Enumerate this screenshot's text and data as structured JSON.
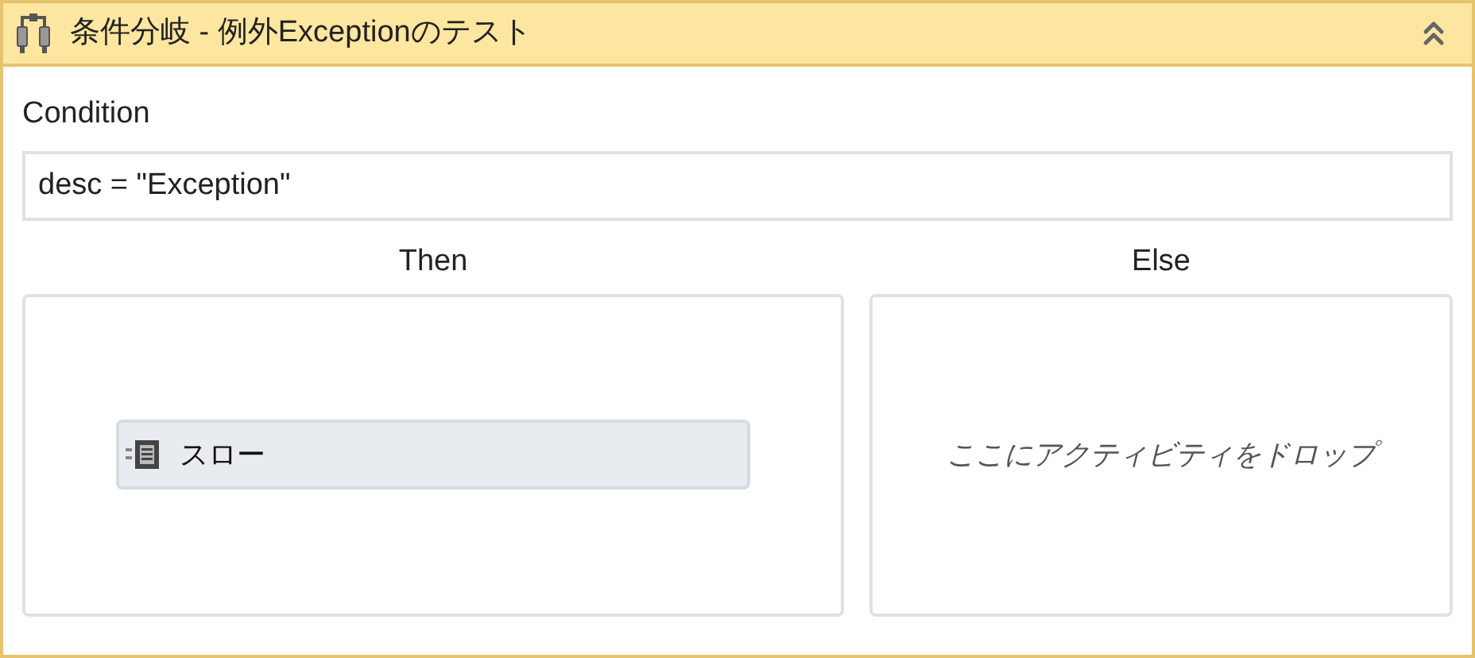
{
  "header": {
    "title": "条件分岐 - 例外Exceptionのテスト",
    "expanded": true
  },
  "condition": {
    "label": "Condition",
    "value": "desc = \"Exception\""
  },
  "branches": [
    {
      "label": "Then",
      "kind": "activities",
      "activities": [
        {
          "label": "スロー"
        }
      ]
    },
    {
      "label": "Else",
      "kind": "empty",
      "placeholder": "ここにアクティビティをドロップ"
    }
  ]
}
